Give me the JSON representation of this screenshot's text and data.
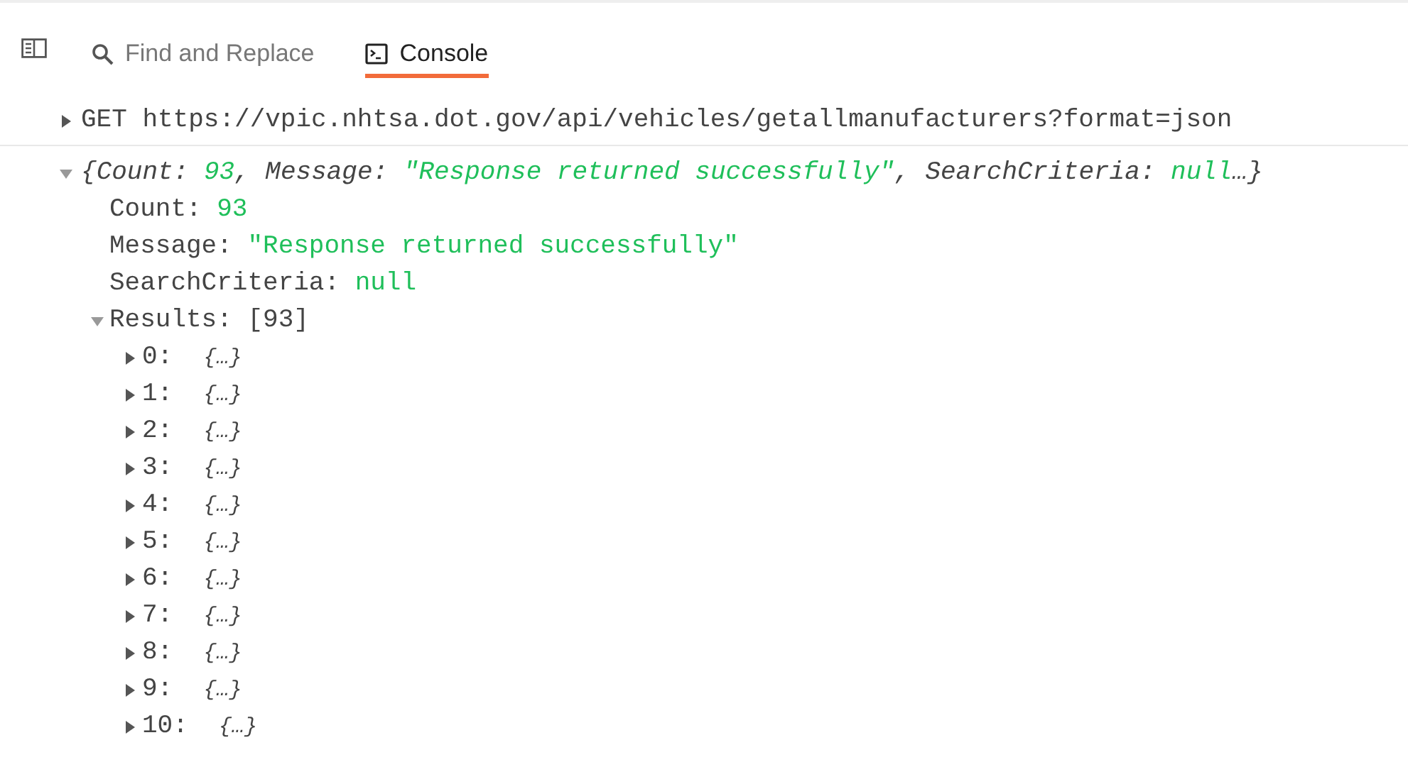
{
  "toolbar": {
    "sidebar_toggle": {
      "selected": false
    },
    "tabs": [
      {
        "label": "Find and Replace",
        "kind": "search",
        "selected": false
      },
      {
        "label": "Console",
        "kind": "terminal",
        "selected": true
      }
    ]
  },
  "request": {
    "method": "GET",
    "url": "https://vpic.nhtsa.dot.gov/api/vehicles/getallmanufacturers?format=json",
    "expanded": false
  },
  "response": {
    "expanded": true,
    "summary": [
      {
        "kind": "punct",
        "text": "{"
      },
      {
        "kind": "key",
        "text": "Count:"
      },
      {
        "kind": "value",
        "text": "93"
      },
      {
        "kind": "punct",
        "text": ","
      },
      {
        "kind": "key",
        "text": "Message:"
      },
      {
        "kind": "value",
        "text": "\"Response returned successfully\""
      },
      {
        "kind": "punct",
        "text": ","
      },
      {
        "kind": "key",
        "text": "SearchCriteria:"
      },
      {
        "kind": "value",
        "text": "null"
      },
      {
        "kind": "punct",
        "text": "…}"
      }
    ],
    "properties": [
      {
        "key": "Count:",
        "value": "93"
      },
      {
        "key": "Message:",
        "value": "\"Response returned successfully\""
      },
      {
        "key": "SearchCriteria:",
        "value": "null"
      }
    ],
    "results": {
      "key": "Results:",
      "value": "[93]",
      "expanded": true,
      "children": [
        {
          "key": "0:",
          "value": "{…}",
          "expanded": false
        },
        {
          "key": "1:",
          "value": "{…}",
          "expanded": false
        },
        {
          "key": "2:",
          "value": "{…}",
          "expanded": false
        },
        {
          "key": "3:",
          "value": "{…}",
          "expanded": false
        },
        {
          "key": "4:",
          "value": "{…}",
          "expanded": false
        },
        {
          "key": "5:",
          "value": "{…}",
          "expanded": false
        },
        {
          "key": "6:",
          "value": "{…}",
          "expanded": false
        },
        {
          "key": "7:",
          "value": "{…}",
          "expanded": false
        },
        {
          "key": "8:",
          "value": "{…}",
          "expanded": false
        },
        {
          "key": "9:",
          "value": "{…}",
          "expanded": false
        },
        {
          "key": "10:",
          "value": "{…}",
          "expanded": false
        }
      ]
    }
  }
}
